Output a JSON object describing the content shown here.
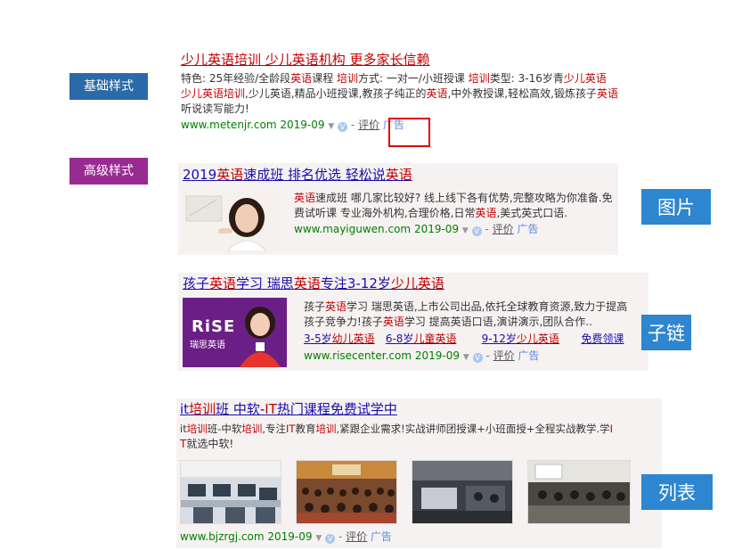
{
  "labels": {
    "basic_style": "基础样式",
    "advanced_style": "高级样式",
    "image_label": "图片",
    "sublink_label": "子链",
    "list_label": "列表"
  },
  "result1": {
    "title": "少儿英语培训 少儿英语机构 更多家长信赖",
    "line1": [
      {
        "t": "特色: 25年经验/全龄段",
        "red": false
      },
      {
        "t": "英语",
        "red": true
      },
      {
        "t": "课程 ",
        "red": false
      },
      {
        "t": "培训",
        "red": true
      },
      {
        "t": "方式: 一对一/小班授课 ",
        "red": false
      },
      {
        "t": "培训",
        "red": true
      },
      {
        "t": "类型: 3-16岁青",
        "red": false
      },
      {
        "t": "少儿英语",
        "red": true
      }
    ],
    "line2": [
      {
        "t": "少儿英语培训",
        "red": true
      },
      {
        "t": ",少儿英语,精品小班授课,教孩子纯正的",
        "red": false
      },
      {
        "t": "英语",
        "red": true
      },
      {
        "t": ",中外教授课,轻松高效,锻炼孩子",
        "red": false
      },
      {
        "t": "英语",
        "red": true
      }
    ],
    "line3": "听说读写能力!",
    "url": "www.metenjr.com",
    "date": "2019-09",
    "review": "评价",
    "ad": "广告"
  },
  "result2": {
    "title_parts": [
      {
        "t": "2019",
        "red": false
      },
      {
        "t": "英语",
        "red": true
      },
      {
        "t": "速成班 排名优选 轻松说",
        "red": false
      },
      {
        "t": "英语",
        "red": true
      }
    ],
    "line1": [
      {
        "t": "英语",
        "red": true
      },
      {
        "t": "速成班 哪几家比较好? 线上线下各有优势,完整攻略为你准备.免",
        "red": false
      }
    ],
    "line2": [
      {
        "t": "费试听课 专业海外机构,合理价格,日常",
        "red": false
      },
      {
        "t": "英语",
        "red": true
      },
      {
        "t": ",美式英式口语.",
        "red": false
      }
    ],
    "url": "www.mayiguwen.com",
    "date": "2019-09",
    "review": "评价",
    "ad": "广告"
  },
  "result3": {
    "title_parts": [
      {
        "t": "孩子",
        "red": false
      },
      {
        "t": "英语",
        "red": true
      },
      {
        "t": "学习 瑞思",
        "red": false
      },
      {
        "t": "英语",
        "red": true
      },
      {
        "t": "专注3-12岁",
        "red": false
      },
      {
        "t": "少儿英语",
        "red": true
      }
    ],
    "line1": [
      {
        "t": "孩子",
        "red": false
      },
      {
        "t": "英语",
        "red": true
      },
      {
        "t": "学习 瑞思英语,上市公司出品,依托全球教育资源,致力于提高",
        "red": false
      }
    ],
    "line2": [
      {
        "t": "孩子竞争力!孩子",
        "red": false
      },
      {
        "t": "英语",
        "red": true
      },
      {
        "t": "学习 提高英语口语,演讲演示,团队合作..",
        "red": false
      }
    ],
    "sublinks": [
      {
        "parts": [
          {
            "t": "3-5岁",
            "red": false
          },
          {
            "t": "幼儿英语",
            "red": true
          }
        ]
      },
      {
        "parts": [
          {
            "t": "6-8岁",
            "red": false
          },
          {
            "t": "儿童英语",
            "red": true
          }
        ]
      },
      {
        "parts": [
          {
            "t": "9-12岁",
            "red": false
          },
          {
            "t": "少儿英语",
            "red": true
          }
        ]
      },
      {
        "parts": [
          {
            "t": "免费领课",
            "red": false
          }
        ]
      }
    ],
    "logo_text": "RiSE",
    "logo_sub": "瑞思英语",
    "url": "www.risecenter.com",
    "date": "2019-09",
    "review": "评价",
    "ad": "广告"
  },
  "result4": {
    "title_parts": [
      {
        "t": "it",
        "red": false
      },
      {
        "t": "培训",
        "red": true
      },
      {
        "t": "班 中软-",
        "red": false
      },
      {
        "t": "IT",
        "red": true
      },
      {
        "t": "热门课程免费试学中",
        "red": false
      }
    ],
    "line1": [
      {
        "t": "it",
        "red": false
      },
      {
        "t": "培训",
        "red": true
      },
      {
        "t": "班-中软",
        "red": false
      },
      {
        "t": "培训",
        "red": true
      },
      {
        "t": ",专注",
        "red": false
      },
      {
        "t": "IT",
        "red": true
      },
      {
        "t": "教育",
        "red": false
      },
      {
        "t": "培训",
        "red": true
      },
      {
        "t": ",紧跟企业需求!实战讲师团授课+小班面授+全程实战教学.学",
        "red": false
      },
      {
        "t": "I",
        "red": true
      }
    ],
    "line2": [
      {
        "t": "T",
        "red": true
      },
      {
        "t": "就选中软!",
        "red": false
      }
    ],
    "url": "www.bjzrgj.com",
    "date": "2019-09",
    "review": "评价",
    "ad": "广告"
  },
  "colors": {
    "link": "#1a0dab",
    "highlight": "#c00000",
    "url_green": "#008000",
    "ad_blue": "#5a8be0",
    "tag_blue": "#2b6aa8",
    "tag_purple": "#9a2a93",
    "side_blue": "#2d86cf",
    "callout_red": "#e00000"
  }
}
